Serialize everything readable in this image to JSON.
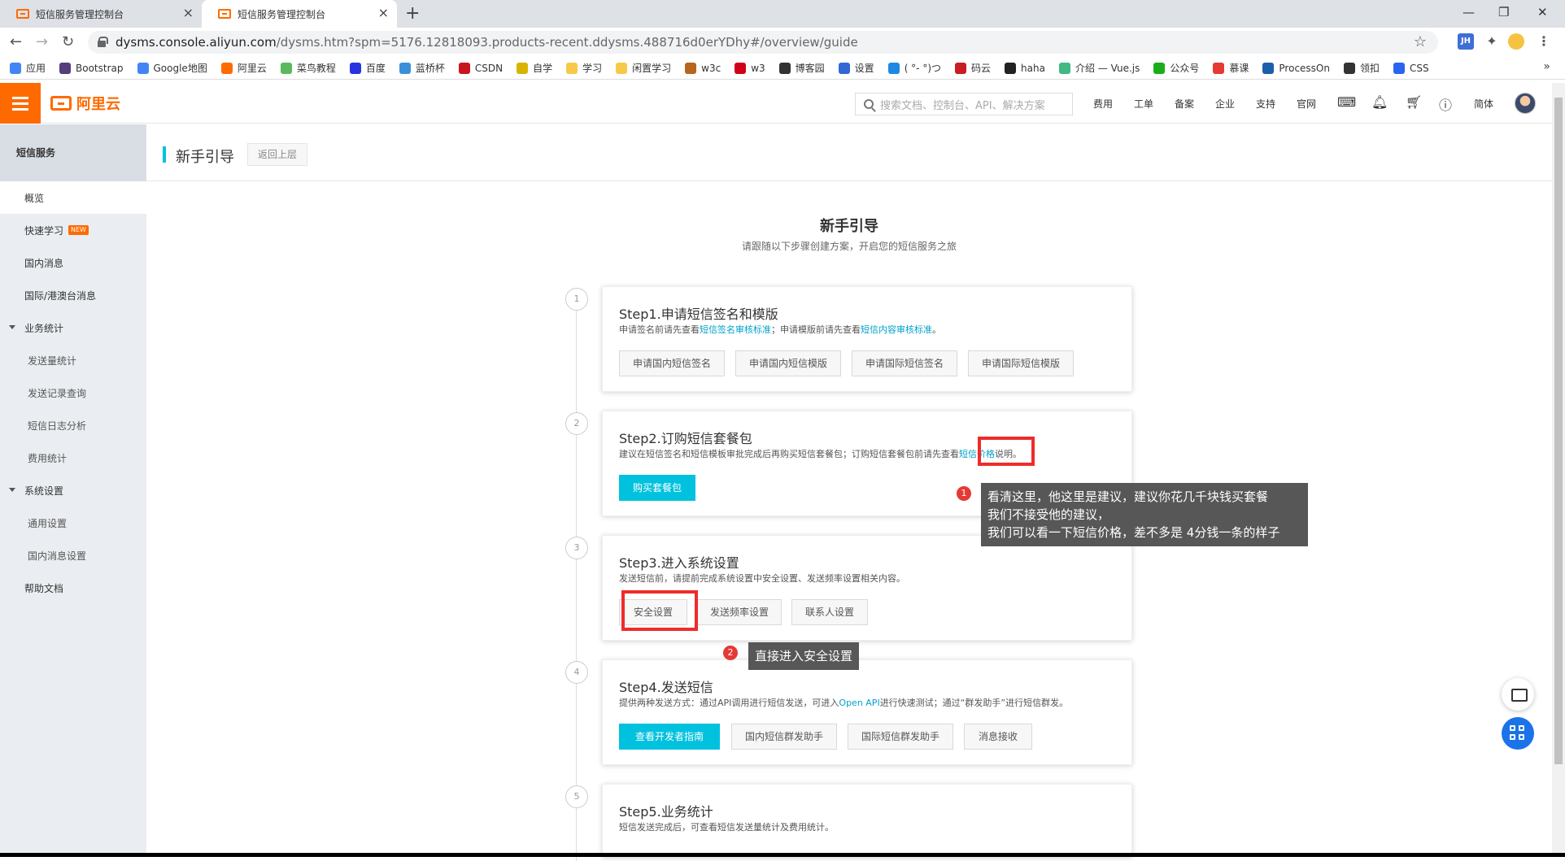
{
  "browser": {
    "tabs": [
      {
        "title": "短信服务管理控制台"
      },
      {
        "title": "短信服务管理控制台"
      }
    ],
    "url_host": "dysms.console.aliyun.com",
    "url_rest": "/dysms.htm?spm=5176.12818093.products-recent.ddysms.488716d0erYDhy#/overview/guide",
    "bookmarks": [
      "应用",
      "Bootstrap",
      "Google地图",
      "阿里云",
      "菜鸟教程",
      "百度",
      "蓝桥杯",
      "CSDN",
      "自学",
      "学习",
      "闲置学习",
      "w3c",
      "w3",
      "博客园",
      "设置",
      "( °- °)つ",
      "码云",
      "haha",
      "介绍 — Vue.js",
      "公众号",
      "慕课",
      "ProcessOn",
      "领扣",
      "CSS"
    ],
    "ext_label": "JH"
  },
  "topbar": {
    "logo_text": "阿里云",
    "search_placeholder": "搜索文档、控制台、API、解决方案",
    "nav": [
      "费用",
      "工单",
      "备案",
      "企业",
      "支持",
      "官网"
    ],
    "lang": "简体"
  },
  "sidebar": {
    "title": "短信服务",
    "items": [
      {
        "label": "概览",
        "kind": "top",
        "active": true
      },
      {
        "label": "快速学习",
        "kind": "top",
        "badge": "NEW"
      },
      {
        "label": "国内消息",
        "kind": "top"
      },
      {
        "label": "国际/港澳台消息",
        "kind": "top"
      },
      {
        "label": "业务统计",
        "kind": "group"
      },
      {
        "label": "发送量统计",
        "kind": "sub"
      },
      {
        "label": "发送记录查询",
        "kind": "sub"
      },
      {
        "label": "短信日志分析",
        "kind": "sub"
      },
      {
        "label": "费用统计",
        "kind": "sub"
      },
      {
        "label": "系统设置",
        "kind": "group"
      },
      {
        "label": "通用设置",
        "kind": "sub"
      },
      {
        "label": "国内消息设置",
        "kind": "sub"
      },
      {
        "label": "帮助文档",
        "kind": "top"
      }
    ]
  },
  "header": {
    "title": "新手引导",
    "back_label": "返回上层"
  },
  "guide": {
    "title": "新手引导",
    "subtitle": "请跟随以下步骤创建方案，开启您的短信服务之旅",
    "steps": [
      {
        "num": "1",
        "title": "Step1.申请短信签名和模版",
        "desc": [
          "申请签名前请先查看",
          "短信签名审核标准",
          "；申请模版前请先查看",
          "短信内容审核标准",
          "。"
        ],
        "buttons": [
          "申请国内短信签名",
          "申请国内短信模版",
          "申请国际短信签名",
          "申请国际短信模版"
        ]
      },
      {
        "num": "2",
        "title": "Step2.订购短信套餐包",
        "desc": [
          "建议在短信签名和短信模板审批完成后再购买短信套餐包；订购短信套餐包前请先查看",
          "短信价格",
          "说明。"
        ],
        "buttons": [
          "购买套餐包"
        ]
      },
      {
        "num": "3",
        "title": "Step3.进入系统设置",
        "desc": [
          "发送短信前，请提前完成系统设置中安全设置、发送频率设置相关内容。"
        ],
        "buttons": [
          "安全设置",
          "发送频率设置",
          "联系人设置"
        ]
      },
      {
        "num": "4",
        "title": "Step4.发送短信",
        "desc": [
          "提供两种发送方式：通过API调用进行短信发送，可进入",
          "Open API",
          "进行快速测试；通过“群发助手”进行短信群发。"
        ],
        "buttons": [
          "查看开发者指南",
          "国内短信群发助手",
          "国际短信群发助手",
          "消息接收"
        ]
      },
      {
        "num": "5",
        "title": "Step5.业务统计",
        "desc": [
          "短信发送完成后，可查看短信发送量统计及费用统计。"
        ],
        "buttons": []
      }
    ]
  },
  "annotations": [
    {
      "num": "1",
      "lines": [
        "看清这里，他这里是建议，建议你花几千块钱买套餐",
        "我们不接受他的建议，",
        "我们可以看一下短信价格，差不多是 4分钱一条的样子"
      ]
    },
    {
      "num": "2",
      "lines": [
        "直接进入安全设置"
      ]
    }
  ],
  "colors": {
    "accent": "#00c1de",
    "brand": "#ff6a00",
    "link": "#00a2ca",
    "highlight": "#ef2b2b"
  }
}
